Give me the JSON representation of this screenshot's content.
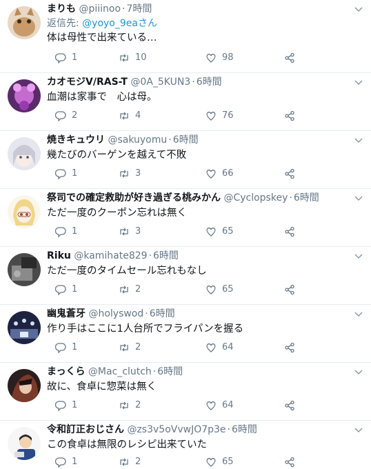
{
  "tweets": [
    {
      "name": "まりも",
      "handle": "@piiinoo",
      "time": "7時間",
      "reply_prefix": "返信先: ",
      "reply_to": "@yoyo_9eaさん",
      "text": "体は母性で出来ている…",
      "replies": "1",
      "retweets": "10",
      "likes": "98",
      "avatar_color": "#c99a6a"
    },
    {
      "name": "カオモジV/RAS-T",
      "handle": "@0A_5KUN3",
      "time": "6時間",
      "text": "血潮は家事で　心は母。",
      "replies": "2",
      "retweets": "4",
      "likes": "76",
      "avatar_color": "#8e3a8f"
    },
    {
      "name": "焼きキュウリ",
      "handle": "@sakuyomu",
      "time": "6時間",
      "text": "幾たびのバーゲンを越えて不敗",
      "replies": "1",
      "retweets": "3",
      "likes": "66",
      "avatar_color": "#d9d9e3"
    },
    {
      "name": "祭司での確定救助が好き過ぎる桃みかん",
      "handle": "@Cyclopskey",
      "time": "6時間",
      "text": "ただ一度のクーポン忘れは無く",
      "replies": "1",
      "retweets": "3",
      "likes": "65",
      "avatar_color": "#f2e2b8"
    },
    {
      "name": "Riku",
      "handle": "@kamihate829",
      "time": "6時間",
      "text": "ただ一度のタイムセール忘れもなし",
      "replies": "1",
      "retweets": "2",
      "likes": "65",
      "avatar_color": "#6b6b6b"
    },
    {
      "name": "幽鬼蒼牙",
      "handle": "@holyswod",
      "time": "6時間",
      "text": "作り手はここに1人台所でフライパンを握る",
      "replies": "1",
      "retweets": "2",
      "likes": "64",
      "avatar_color": "#2a3450"
    },
    {
      "name": "まっくら",
      "handle": "@Mac_clutch",
      "time": "6時間",
      "text": "故に、食卓に惣菜は無く",
      "replies": "1",
      "retweets": "2",
      "likes": "64",
      "avatar_color": "#3a2a2a"
    },
    {
      "name": "令和訂正おじさん",
      "handle": "@zs3v5oVvwJO7p3e",
      "time": "6時間",
      "text": "この食卓は無限のレシピ出来ていた",
      "replies": "1",
      "retweets": "2",
      "likes": "65",
      "avatar_color": "#f4f4f4"
    }
  ]
}
